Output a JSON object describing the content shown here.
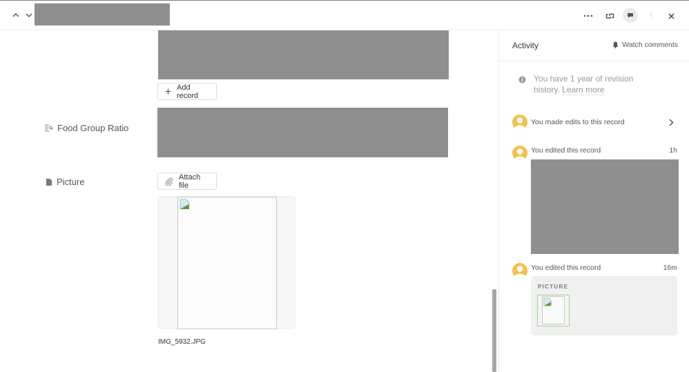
{
  "header": {
    "prev_record_icon": "chevron-up-icon",
    "next_record_icon": "chevron-down-icon",
    "record_title": "",
    "more_icon": "more-horizontal-icon",
    "expand_icon": "link-expand-icon",
    "comments_icon": "comment-bubble-icon",
    "close_icon": "close-icon"
  },
  "main": {
    "add_record_label": "Add record",
    "fields": [
      {
        "label": "Food Group Ratio",
        "icon": "lookup-list-icon"
      },
      {
        "label": "Picture",
        "icon": "document-icon"
      }
    ],
    "attach_file_label": "Attach file",
    "attachment": {
      "filename": "IMG_5932.JPG"
    }
  },
  "activity": {
    "title": "Activity",
    "watch_label": "Watch comments",
    "info_text": "You have 1 year of revision history.",
    "learn_more": "Learn more",
    "items": [
      {
        "text": "You made edits to this record",
        "time": ""
      },
      {
        "text": "You edited this record",
        "time": "1h"
      },
      {
        "text": "You edited this record",
        "time": "16m",
        "field_label": "PICTURE"
      }
    ]
  }
}
